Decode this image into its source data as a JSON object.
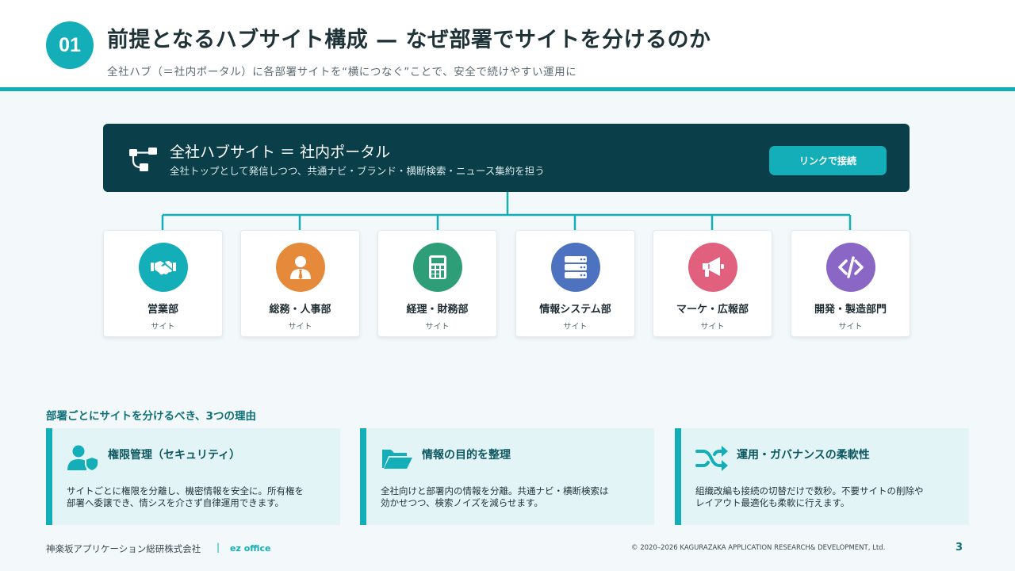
{
  "header": {
    "badge": "01",
    "title": "前提となるハブサイト構成 — なぜ部署でサイトを分けるのか",
    "subtitle": "全社ハブ（＝社内ポータル）に各部署サイトを“横につなぐ”ことで、安全で続けやすい運用に"
  },
  "hub": {
    "icon": "sitemap-icon",
    "title": "全社ハブサイト ＝ 社内ポータル",
    "description": "全社トップとして発信しつつ、共通ナビ・ブランド・横断検索・ニュース集約を担う",
    "button_label": "リンクで接続"
  },
  "departments": [
    {
      "name": "営業部",
      "sub": "サイト",
      "icon": "handshake-icon",
      "color": "#13aeb8"
    },
    {
      "name": "総務・人事部",
      "sub": "サイト",
      "icon": "user-tie-icon",
      "color": "#e58a3a"
    },
    {
      "name": "経理・財務部",
      "sub": "サイト",
      "icon": "calculator-icon",
      "color": "#2e9e78"
    },
    {
      "name": "情報システム部",
      "sub": "サイト",
      "icon": "server-icon",
      "color": "#4d73c0"
    },
    {
      "name": "マーケ・広報部",
      "sub": "サイト",
      "icon": "megaphone-icon",
      "color": "#e0607e"
    },
    {
      "name": "開発・製造部門",
      "sub": "サイト",
      "icon": "code-icon",
      "color": "#8a67c4"
    }
  ],
  "reasons": {
    "title": "部署ごとにサイトを分けるべき、3つの理由",
    "items": [
      {
        "icon": "user-shield-icon",
        "title": "権限管理（セキュリティ）",
        "body": "サイトごとに権限を分離し、機密情報を安全に。所有権を\n部署へ委譲でき、情シスを介さず自律運用できます。"
      },
      {
        "icon": "folder-open-icon",
        "title": "情報の目的を整理",
        "body": "全社向けと部署内の情報を分離。共通ナビ・横断検索は\n効かせつつ、検索ノイズを減らせます。"
      },
      {
        "icon": "shuffle-icon",
        "title": "運用・ガバナンスの柔軟性",
        "body": "組織改編も接続の切替だけで数秒。不要サイトの削除や\nレイアウト最適化も柔軟に行えます。"
      }
    ]
  },
  "footer": {
    "company": "神楽坂アプリケーション総研株式会社",
    "separator": "|",
    "brand": "ez office",
    "copyright": "© 2020–2026 KAGURAZAKA APPLICATION RESEARCH& DEVELOPMENT, Ltd.",
    "page": "3"
  },
  "colors": {
    "accent": "#13aeb8",
    "hub_bg": "#0a3f49",
    "reason_bg": "#e3f4f6"
  }
}
